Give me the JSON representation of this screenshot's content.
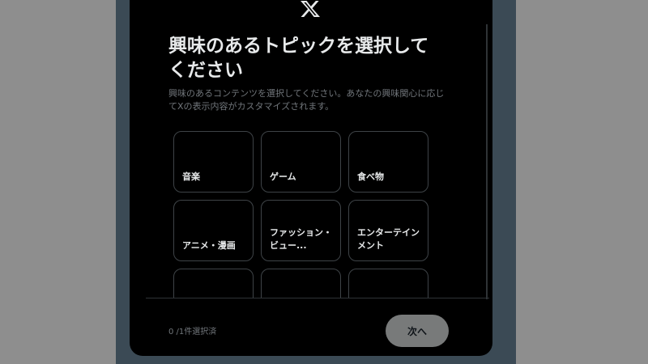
{
  "header": {
    "logo_icon": "x-logo-icon"
  },
  "title": "興味のあるトピックを選択してください",
  "subtitle": "興味のあるコンテンツを選択してください。あなたの興味関心に応じてXの表示内容がカスタマイズされます。",
  "topics": [
    {
      "label": "音楽"
    },
    {
      "label": "ゲーム"
    },
    {
      "label": "食べ物"
    },
    {
      "label": "アニメ・漫画"
    },
    {
      "label": "ファッション・ビュー..."
    },
    {
      "label": "エンターテインメント"
    },
    {
      "label": ""
    },
    {
      "label": ""
    },
    {
      "label": ""
    }
  ],
  "footer": {
    "selection_count": "0 /1件選択済",
    "next_label": "次へ"
  },
  "colors": {
    "modal_background": "#000000",
    "backdrop": "#8e8e8e",
    "button_disabled": "#787a7a",
    "text_primary": "#e7e9ea",
    "text_secondary": "#71767b",
    "tile_border": "#3e4347"
  }
}
